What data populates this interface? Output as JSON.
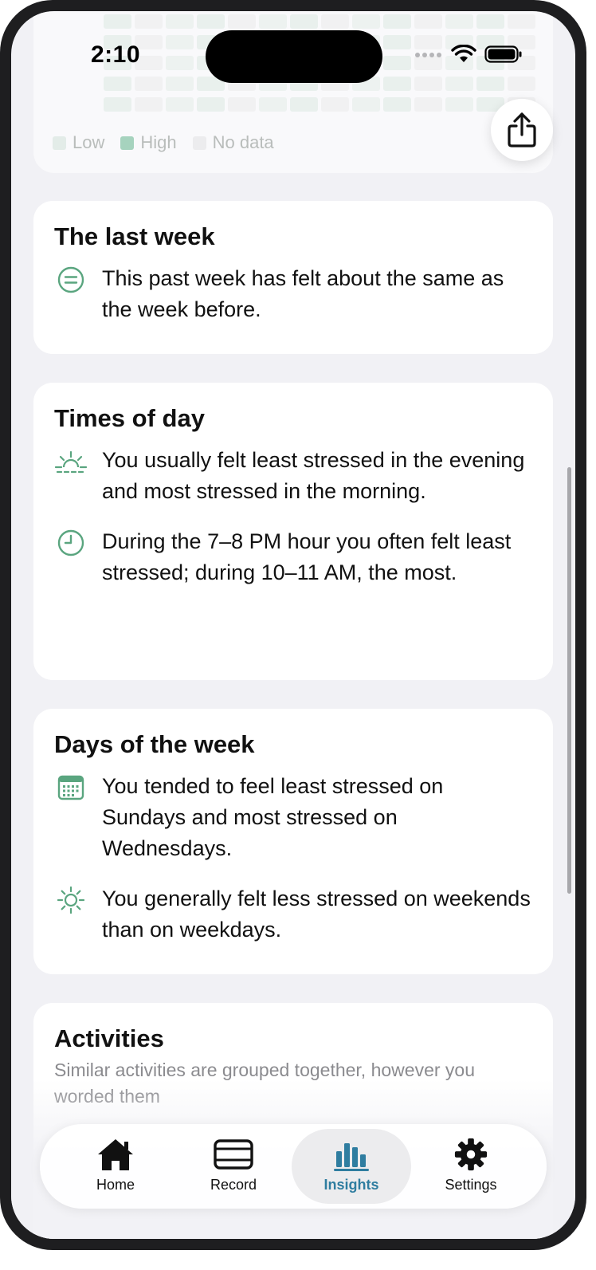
{
  "status_bar": {
    "time": "2:10"
  },
  "legend": [
    {
      "label": "Low",
      "color": "#e3ece8"
    },
    {
      "label": "High",
      "color": "#a6d3be"
    },
    {
      "label": "No data",
      "color": "#ececee"
    }
  ],
  "share_icon": "share-icon",
  "cards": {
    "last_week": {
      "title": "The last week",
      "insights": [
        {
          "icon": "equal-circle-icon",
          "text": "This past week has felt about the same as the week before."
        }
      ]
    },
    "times_of_day": {
      "title": "Times of day",
      "insights": [
        {
          "icon": "sunrise-icon",
          "text": "You usually felt least stressed in the evening and most stressed in the morning."
        },
        {
          "icon": "clock-icon",
          "text": "During the 7–8 PM hour you often felt least stressed; during 10–11 AM, the most."
        }
      ]
    },
    "days_of_week": {
      "title": "Days of the week",
      "insights": [
        {
          "icon": "calendar-icon",
          "text": "You tended to feel least stressed on Sundays and most stressed on Wednesdays."
        },
        {
          "icon": "sun-icon",
          "text": "You generally felt less stressed on weekends than on weekdays."
        }
      ]
    },
    "activities": {
      "title": "Activities",
      "subtitle": "Similar activities are grouped together, however you worded them"
    }
  },
  "tabbar": {
    "tabs": [
      {
        "label": "Home",
        "icon": "house-icon",
        "active": false
      },
      {
        "label": "Record",
        "icon": "record-icon",
        "active": false
      },
      {
        "label": "Insights",
        "icon": "chart-icon",
        "active": true
      },
      {
        "label": "Settings",
        "icon": "gear-icon",
        "active": false
      }
    ]
  },
  "colors": {
    "accent_green": "#5aa57f",
    "active_tab": "#2f7da0",
    "background": "#f1f1f5"
  }
}
